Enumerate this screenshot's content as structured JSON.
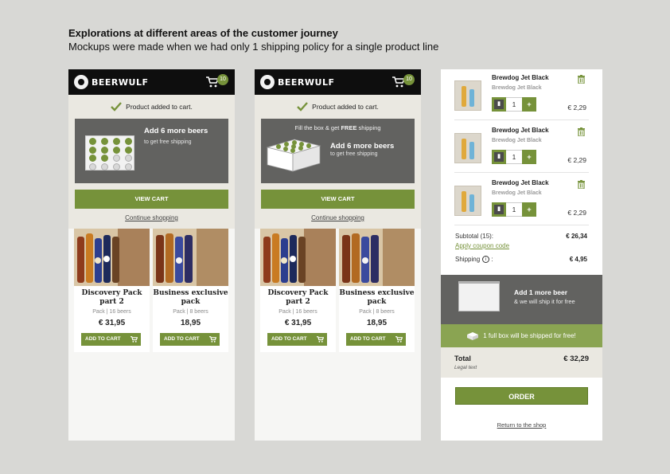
{
  "header": {
    "title": "Explorations at different areas of the customer journey",
    "subtitle": "Mockups were made when we had only 1 shipping policy for a single product line"
  },
  "brand": {
    "name": "BEERWULF",
    "accent": "#76923a",
    "dark": "#0e0e0e"
  },
  "phone1": {
    "cart_count": "10",
    "added_msg": "Product added to cart.",
    "promo_title": "Add 6 more beers",
    "promo_sub": "to get free shipping",
    "view_cart": "VIEW CART",
    "continue": "Continue shopping"
  },
  "phone2": {
    "cart_count": "10",
    "added_msg": "Product added to cart.",
    "promo_top_a": "Fill the box & get ",
    "promo_top_b": "FREE",
    "promo_top_c": " shipping",
    "promo_title": "Add 6 more beers",
    "promo_sub": "to get free shipping",
    "view_cart": "VIEW CART",
    "continue": "Continue shopping"
  },
  "products": [
    {
      "name": "Discovery Pack part 2",
      "meta": "Pack | 16 beers",
      "price": "€ 31,95",
      "add": "ADD TO CART"
    },
    {
      "name": "Business exclusive pack",
      "meta": "Pack | 8 beers",
      "price": "18,95",
      "add": "ADD TO CART"
    }
  ],
  "cart": {
    "items": [
      {
        "name": "Brewdog Jet Black",
        "sub": "Brewdog Jet Black",
        "qty": "1",
        "price": "€ 2,29"
      },
      {
        "name": "Brewdog Jet Black",
        "sub": "Brewdog Jet Black",
        "qty": "1",
        "price": "€ 2,29"
      },
      {
        "name": "Brewdog Jet Black",
        "sub": "Brewdog Jet Black",
        "qty": "1",
        "price": "€ 2,29"
      }
    ],
    "subtotal_label": "Subtotal (15):",
    "subtotal_value": "€ 26,34",
    "coupon": "Apply coupon code",
    "shipping_label": "Shipping",
    "shipping_colon": ":",
    "shipping_value": "€ 4,95",
    "promo_title": "Add 1 more beer",
    "promo_sub": "& we will ship it for free",
    "free_msg": "1 full box will be shipped for free!",
    "total_label": "Total",
    "legal": "Legal text",
    "total_value": "€ 32,29",
    "order": "ORDER",
    "return": "Return to the shop",
    "minus_glyph": "▮",
    "plus_glyph": "+",
    "info_glyph": "i"
  }
}
